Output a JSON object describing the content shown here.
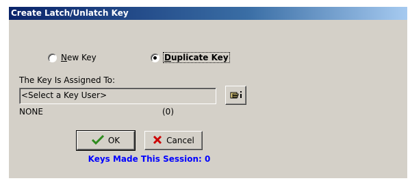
{
  "window": {
    "title": "Create Latch/Unlatch Key"
  },
  "key_type": {
    "options": [
      {
        "label": "New Key",
        "accel": "N",
        "selected": false
      },
      {
        "label": "Duplicate Key",
        "accel": "D",
        "selected": true
      }
    ]
  },
  "assignment": {
    "label": "The Key Is Assigned To:",
    "field_value": "<Select a Key User>",
    "lookup_icon": "hand-pointer-icon",
    "user_name": "NONE",
    "user_count": "(0)"
  },
  "buttons": {
    "ok_label": "OK",
    "cancel_label": "Cancel"
  },
  "status": {
    "session_text": "Keys Made This Session: 0"
  },
  "colors": {
    "dialog_bg": "#d4d0c8",
    "title_start": "#0a246a",
    "title_end": "#a6caf0",
    "session_text": "#0000ff",
    "ok_check": "#2e8b1e",
    "cancel_x": "#cc0000"
  }
}
